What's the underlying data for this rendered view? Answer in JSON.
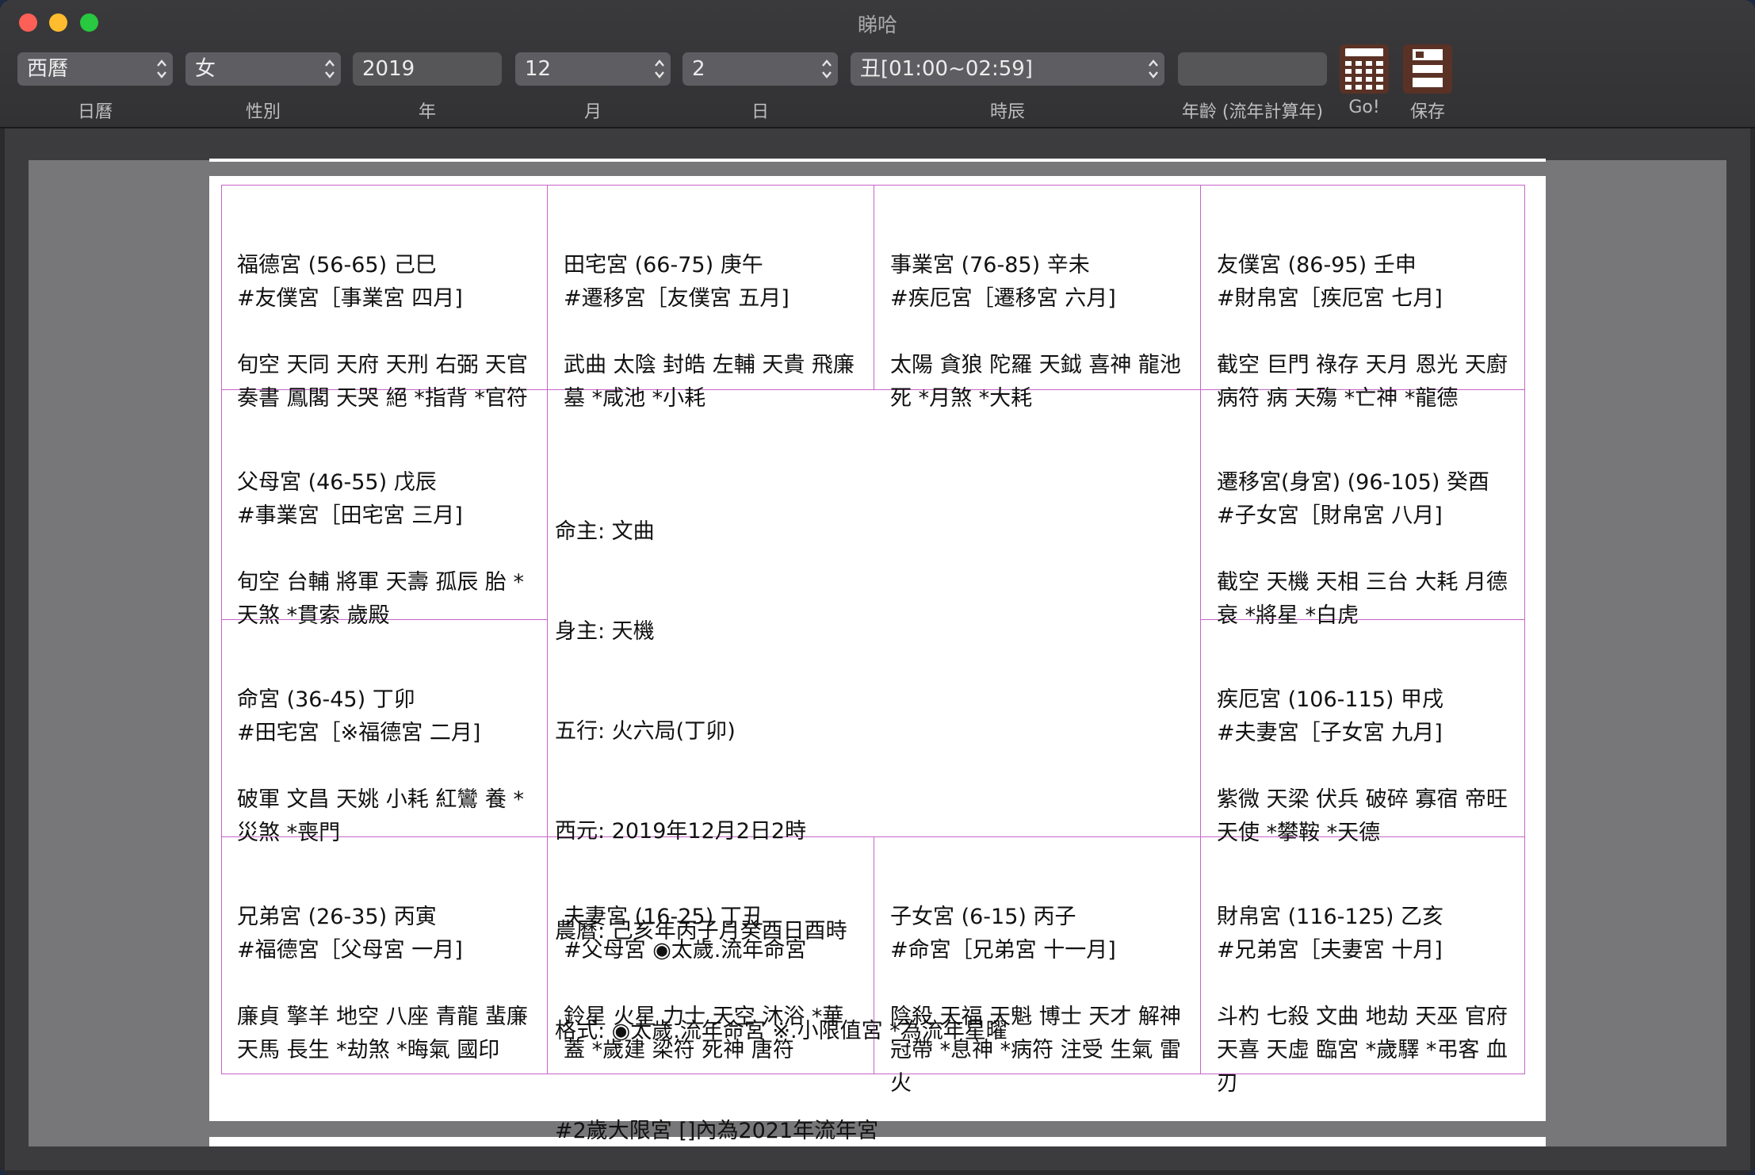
{
  "window": {
    "title": "睇哈"
  },
  "toolbar": {
    "calendar": {
      "value": "西曆",
      "label": "日曆"
    },
    "gender": {
      "value": "女",
      "label": "性別"
    },
    "year": {
      "value": "2019",
      "label": "年"
    },
    "month": {
      "value": "12",
      "label": "月"
    },
    "day": {
      "value": "2",
      "label": "日"
    },
    "hour": {
      "value": "丑[01:00~02:59]",
      "label": "時辰"
    },
    "age": {
      "value": "",
      "label": "年齡 (流年計算年)"
    },
    "go_label": "Go!",
    "save_label": "保存"
  },
  "chart": {
    "cells": [
      {
        "id": "fude",
        "header": "福德宮 (56-65) 己巳",
        "ref": "#友僕宮［事業宮 四月]",
        "stars": "旬空 天同 天府 天刑 右弼 天官 奏書 鳳閣 天哭 絕 *指背 *官符"
      },
      {
        "id": "tianzhai",
        "header": "田宅宮 (66-75) 庚午",
        "ref": "#遷移宮［友僕宮 五月]",
        "stars": "武曲 太陰 封皓 左輔 天貴 飛廉 墓 *咸池 *小耗"
      },
      {
        "id": "shiye",
        "header": "事業宮 (76-85) 辛未",
        "ref": "#疾厄宮［遷移宮 六月]",
        "stars": "太陽 貪狼 陀羅 天鉞 喜神 龍池 死 *月煞 *大耗"
      },
      {
        "id": "youpu",
        "header": "友僕宮 (86-95) 壬申",
        "ref": "#財帛宮［疾厄宮 七月]",
        "stars": "截空 巨門 祿存 天月 恩光 天廚 病符 病 天殤 *亡神 *龍德"
      },
      {
        "id": "fumu",
        "header": "父母宮 (46-55) 戊辰",
        "ref": "#事業宮［田宅宮 三月]",
        "stars": "旬空 台輔 將軍 天壽 孤辰 胎 *天煞 *貫索 歲殿"
      },
      {
        "id": "qianyi",
        "header": "遷移宮(身宮) (96-105) 癸酉",
        "ref": "#子女宮［財帛宮 八月]",
        "stars": "截空 天機 天相 三台 大耗 月德 衰 *將星 *白虎"
      },
      {
        "id": "ming",
        "header": "命宮 (36-45) 丁卯",
        "ref": "#田宅宮［※福德宮 二月]",
        "stars": "破軍 文昌 天姚 小耗 紅鸞 養 *災煞 *喪門"
      },
      {
        "id": "jie",
        "header": "疾厄宮 (106-115) 甲戌",
        "ref": "#夫妻宮［子女宮 九月]",
        "stars": "紫微 天梁 伏兵 破碎 寡宿 帝旺 天使 *攀鞍 *天德"
      },
      {
        "id": "xiongdi",
        "header": "兄弟宮 (26-35) 丙寅",
        "ref": "#福德宮［父母宮 一月]",
        "stars": "廉貞 擎羊 地空 八座 青龍 蜚廉 天馬 長生 *劫煞 *晦氣 國印"
      },
      {
        "id": "fuqi",
        "header": "夫妻宮 (16-25) 丁丑",
        "ref": "#父母宮 ◉太歲.流年命宮",
        "stars": "鈴星 火星 力士 天空 沐浴 *華蓋 *歲建 梁符 死神 唐符"
      },
      {
        "id": "zinu",
        "header": "子女宮 (6-15) 丙子",
        "ref": "#命宮［兄弟宮 十一月]",
        "stars": "陰殺 天福 天魁 博士 天才 解神 冠帶 *息神 *病符 注受 生氣 雷火"
      },
      {
        "id": "caibo",
        "header": "財帛宮 (116-125) 乙亥",
        "ref": "#兄弟宮［夫妻宮 十月]",
        "stars": "斗杓 七殺 文曲 地劫 天巫 官府 天喜 天虛 臨宮 *歲驛 *弔客 血刃"
      }
    ],
    "center": {
      "line1": "命主: 文曲",
      "line2": "身主: 天機",
      "line3": "五行: 火六局(丁卯)",
      "line4": "西元: 2019年12月2日2時",
      "line5": "農曆: 己亥年丙子月癸酉日酉時",
      "line6": "格式: ◉太歲.流年命宮 ※.小限值宮 *為流年星曜",
      "line7": "#2歲大限宮 []內為2021年流年宮"
    }
  }
}
